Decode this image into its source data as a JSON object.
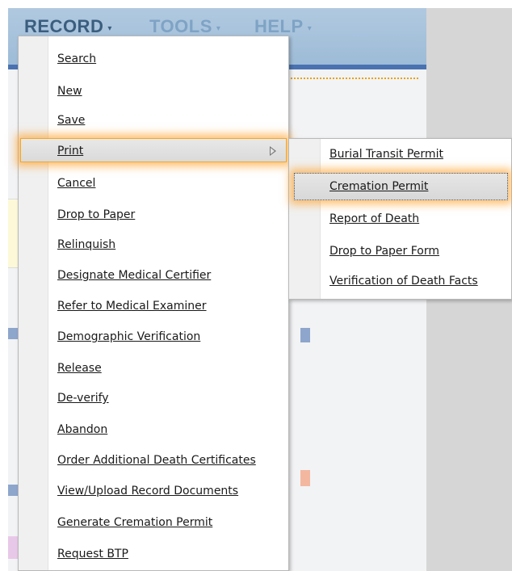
{
  "menubar": {
    "record_label": "RECORD",
    "tools_label": "TOOLS",
    "help_label": "HELP",
    "caret": "▾"
  },
  "record_menu": {
    "items": [
      "Search",
      "New",
      "Save",
      "Print",
      "Cancel",
      "Drop to Paper",
      "Relinquish",
      "Designate Medical Certifier",
      "Refer to Medical Examiner",
      "Demographic Verification",
      "Release",
      "De-verify",
      "Abandon",
      "Order Additional Death Certificates",
      "View/Upload Record Documents",
      "Generate Cremation Permit",
      "Request BTP"
    ],
    "highlighted": "Print"
  },
  "print_submenu": {
    "items": [
      "Burial Transit Permit",
      "Cremation Permit",
      "Report of Death",
      "Drop to Paper Form",
      "Verification of Death Facts"
    ],
    "highlighted": "Cremation Permit"
  },
  "colors": {
    "highlight_glow": "#ffa028",
    "topbar": "#9cbad6",
    "menubar_active": "#3b5e7f",
    "menubar_inactive": "#7fa3c5"
  },
  "icons": {
    "submenu_arrow": "triangle-right-icon"
  }
}
